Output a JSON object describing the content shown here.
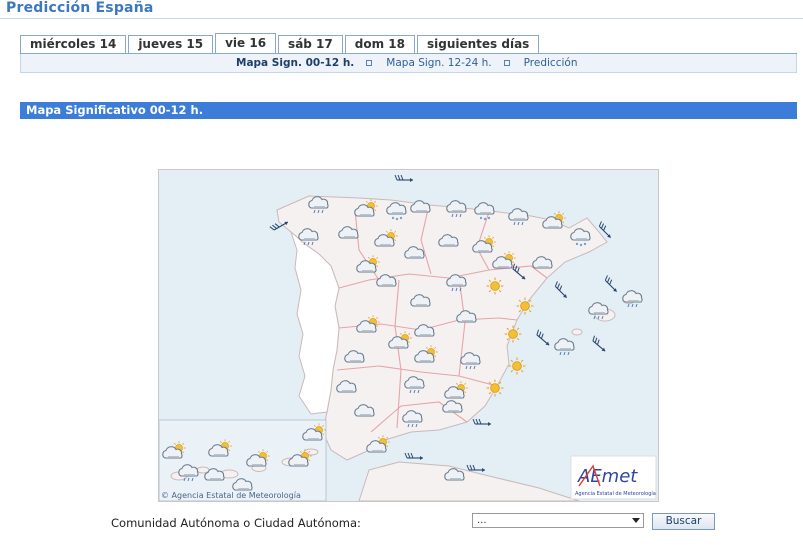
{
  "header": {
    "title": "Predicción España"
  },
  "tabs": [
    {
      "label": "miércoles 14",
      "active": false
    },
    {
      "label": "jueves 15",
      "active": false
    },
    {
      "label": "vie 16",
      "active": true
    },
    {
      "label": "sáb 17",
      "active": false
    },
    {
      "label": "dom 18",
      "active": false
    },
    {
      "label": "siguientes días",
      "active": false
    }
  ],
  "subnav": [
    {
      "label": "Mapa Sign. 00-12 h.",
      "active": true
    },
    {
      "label": "Mapa Sign. 12-24 h.",
      "active": false
    },
    {
      "label": "Predicción",
      "active": false
    }
  ],
  "section": {
    "title": "Mapa Significativo 00-12 h."
  },
  "map": {
    "copyright": "© Agencia Estatal de Meteorología",
    "logo_text": "AEmet",
    "logo_subtitle": "Agencia Estatal de Meteorología",
    "colors": {
      "sea": "#e3eef5",
      "land": "#f4f0f0",
      "borders": "#e6a3a8",
      "sun": "#f2b632",
      "cloud": "#8e9dab"
    }
  },
  "form": {
    "label": "Comunidad Autónoma o Ciudad Autónoma:",
    "select_value": "...",
    "search_label": "Buscar"
  },
  "colors": {
    "accent": "#3b7dd8",
    "title": "#3a78c2"
  }
}
